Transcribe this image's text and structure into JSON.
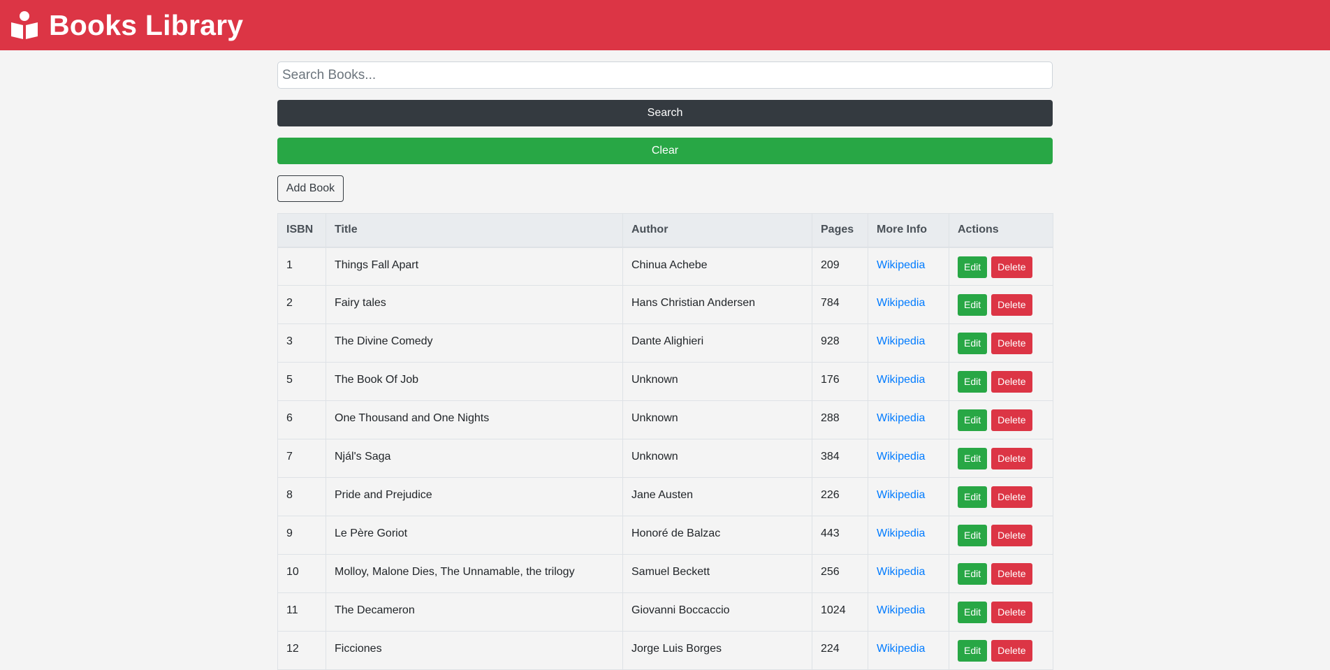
{
  "navbar": {
    "title": "Books Library",
    "icon": "book-reader-icon"
  },
  "search": {
    "placeholder": "Search Books...",
    "value": ""
  },
  "buttons": {
    "search": "Search",
    "clear": "Clear",
    "add": "Add Book"
  },
  "colors": {
    "navbar": "#dc3545",
    "search_button": "#343a40",
    "clear_button": "#28a745",
    "edit_button": "#28a745",
    "delete_button": "#dc3545",
    "link": "#007bff"
  },
  "table": {
    "headers": [
      "ISBN",
      "Title",
      "Author",
      "Pages",
      "More Info",
      "Actions"
    ],
    "rows": [
      {
        "isbn": "1",
        "title": "Things Fall Apart",
        "author": "Chinua Achebe",
        "pages": "209",
        "info": "Wikipedia",
        "edit": "Edit",
        "delete": "Delete"
      },
      {
        "isbn": "2",
        "title": "Fairy tales",
        "author": "Hans Christian Andersen",
        "pages": "784",
        "info": "Wikipedia",
        "edit": "Edit",
        "delete": "Delete"
      },
      {
        "isbn": "3",
        "title": "The Divine Comedy",
        "author": "Dante Alighieri",
        "pages": "928",
        "info": "Wikipedia",
        "edit": "Edit",
        "delete": "Delete"
      },
      {
        "isbn": "5",
        "title": "The Book Of Job",
        "author": "Unknown",
        "pages": "176",
        "info": "Wikipedia",
        "edit": "Edit",
        "delete": "Delete"
      },
      {
        "isbn": "6",
        "title": "One Thousand and One Nights",
        "author": "Unknown",
        "pages": "288",
        "info": "Wikipedia",
        "edit": "Edit",
        "delete": "Delete"
      },
      {
        "isbn": "7",
        "title": "Njál's Saga",
        "author": "Unknown",
        "pages": "384",
        "info": "Wikipedia",
        "edit": "Edit",
        "delete": "Delete"
      },
      {
        "isbn": "8",
        "title": "Pride and Prejudice",
        "author": "Jane Austen",
        "pages": "226",
        "info": "Wikipedia",
        "edit": "Edit",
        "delete": "Delete"
      },
      {
        "isbn": "9",
        "title": "Le Père Goriot",
        "author": "Honoré de Balzac",
        "pages": "443",
        "info": "Wikipedia",
        "edit": "Edit",
        "delete": "Delete"
      },
      {
        "isbn": "10",
        "title": "Molloy, Malone Dies, The Unnamable, the trilogy",
        "author": "Samuel Beckett",
        "pages": "256",
        "info": "Wikipedia",
        "edit": "Edit",
        "delete": "Delete"
      },
      {
        "isbn": "11",
        "title": "The Decameron",
        "author": "Giovanni Boccaccio",
        "pages": "1024",
        "info": "Wikipedia",
        "edit": "Edit",
        "delete": "Delete"
      },
      {
        "isbn": "12",
        "title": "Ficciones",
        "author": "Jorge Luis Borges",
        "pages": "224",
        "info": "Wikipedia",
        "edit": "Edit",
        "delete": "Delete"
      }
    ]
  }
}
